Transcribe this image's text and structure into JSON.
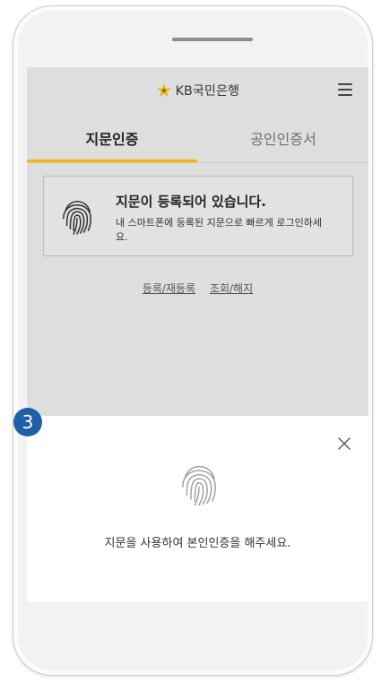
{
  "app": {
    "bank_name": "KB국민은행",
    "logo_icon": "kb-star-logo-icon",
    "menu_icon": "hamburger-menu-icon"
  },
  "tabs": [
    {
      "label": "지문인증",
      "active": true
    },
    {
      "label": "공인인증서",
      "active": false
    }
  ],
  "card": {
    "icon": "fingerprint-icon",
    "title": "지문이 등록되어 있습니다.",
    "description": "내 스마트폰에 등록된 지문으로 빠르게 로그인하세요."
  },
  "links": {
    "register": "등록/재등록",
    "manage": "조회/해지"
  },
  "sheet": {
    "close_icon": "close-icon",
    "fingerprint_icon": "fingerprint-icon",
    "message": "지문을 사용하여 본인인증을 해주세요."
  },
  "step_badge": "3",
  "colors": {
    "accent": "#f2b705",
    "badge": "#1f5fa8"
  }
}
